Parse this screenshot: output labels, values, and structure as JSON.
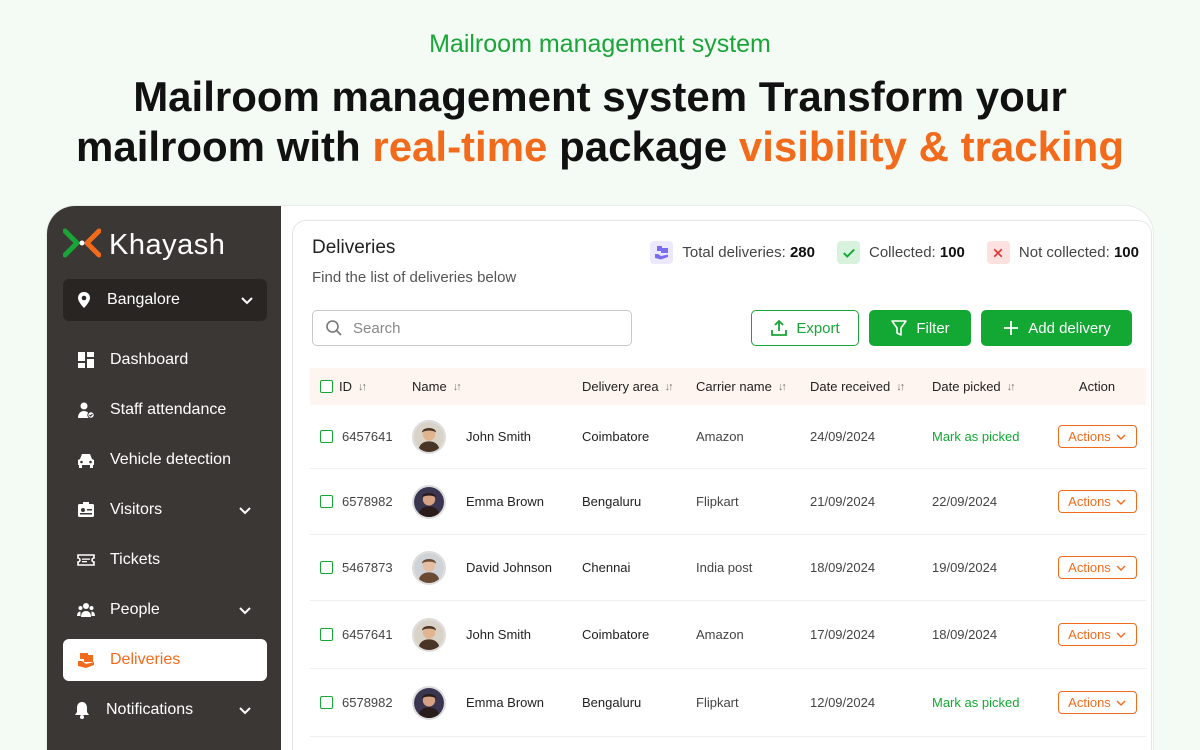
{
  "hero": {
    "eyebrow": "Mailroom management system",
    "title_line1": "Mailroom management system Transform your",
    "title_line2_a": "mailroom with ",
    "title_line2_b": "real-time",
    "title_line2_c": " package ",
    "title_line2_d": "visibility & tracking"
  },
  "sidebar": {
    "brand": "Khayash",
    "location": "Bangalore",
    "items": [
      {
        "label": "Dashboard",
        "icon": "dashboard-icon"
      },
      {
        "label": "Staff attendance",
        "icon": "staff-icon"
      },
      {
        "label": "Vehicle detection",
        "icon": "car-icon"
      },
      {
        "label": "Visitors",
        "icon": "id-card-icon"
      },
      {
        "label": "Tickets",
        "icon": "ticket-icon"
      },
      {
        "label": "People",
        "icon": "people-icon"
      },
      {
        "label": "Deliveries",
        "icon": "package-icon",
        "active": true
      },
      {
        "label": "Notifications",
        "icon": "bell-icon"
      }
    ]
  },
  "main": {
    "title": "Deliveries",
    "subtitle": "Find the list of deliveries below",
    "stats": {
      "total_label": "Total deliveries:",
      "total_value": "280",
      "collected_label": "Collected:",
      "collected_value": "100",
      "not_collected_label": "Not collected:",
      "not_collected_value": "100"
    },
    "search_placeholder": "Search",
    "buttons": {
      "export": "Export",
      "filter": "Filter",
      "add": "Add delivery"
    },
    "columns": {
      "id": "ID",
      "name": "Name",
      "area": "Delivery area",
      "carrier": "Carrier name",
      "received": "Date received",
      "picked": "Date picked",
      "action": "Action"
    },
    "rows": [
      {
        "id": "6457641",
        "name": "John Smith",
        "area": "Coimbatore",
        "carrier": "Amazon",
        "received": "24/09/2024",
        "picked": "Mark as picked",
        "action": "Actions"
      },
      {
        "id": "6578982",
        "name": "Emma Brown",
        "area": "Bengaluru",
        "carrier": "Flipkart",
        "received": "21/09/2024",
        "picked": "22/09/2024",
        "action": "Actions"
      },
      {
        "id": "5467873",
        "name": "David Johnson",
        "area": "Chennai",
        "carrier": "India post",
        "received": "18/09/2024",
        "picked": "19/09/2024",
        "action": "Actions"
      },
      {
        "id": "6457641",
        "name": "John Smith",
        "area": "Coimbatore",
        "carrier": "Amazon",
        "received": "17/09/2024",
        "picked": "18/09/2024",
        "action": "Actions"
      },
      {
        "id": "6578982",
        "name": "Emma Brown",
        "area": "Bengaluru",
        "carrier": "Flipkart",
        "received": "12/09/2024",
        "picked": "Mark as picked",
        "action": "Actions"
      }
    ]
  },
  "colors": {
    "accent_green": "#12a833",
    "accent_orange": "#f26b1d",
    "sidebar_bg": "#3b3735"
  }
}
